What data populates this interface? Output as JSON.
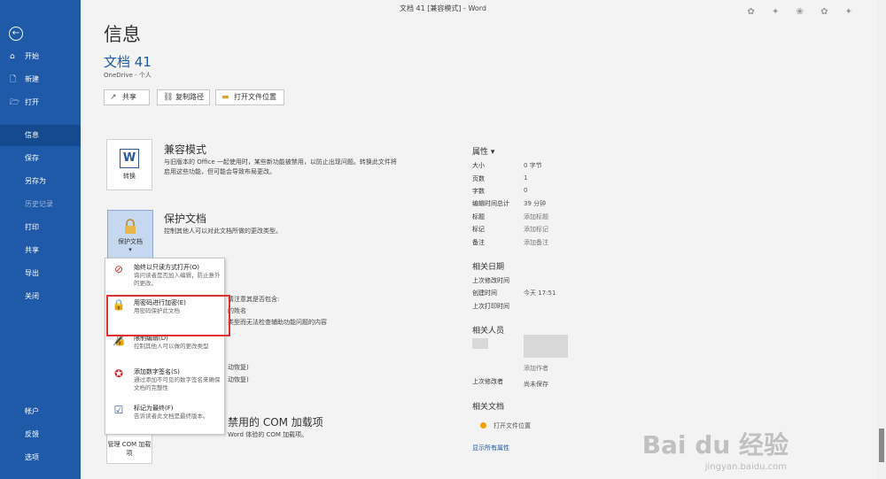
{
  "titlebar": {
    "title": "文档 41 [兼容模式] - Word"
  },
  "nav": {
    "back": "←",
    "items": [
      {
        "label": "开始",
        "icon": "⌂"
      },
      {
        "label": "新建",
        "icon": "🗋"
      },
      {
        "label": "打开",
        "icon": "🗁"
      },
      {
        "label": "信息"
      },
      {
        "label": "保存"
      },
      {
        "label": "另存为"
      },
      {
        "label": "历史记录"
      },
      {
        "label": "打印"
      },
      {
        "label": "共享"
      },
      {
        "label": "导出"
      },
      {
        "label": "关闭"
      },
      {
        "label": "帐户"
      },
      {
        "label": "反馈"
      },
      {
        "label": "选项"
      }
    ]
  },
  "main": {
    "title": "信息",
    "doc_name": "文档 41",
    "location": "OneDrive - 个人",
    "buttons": {
      "share": "共享",
      "copy_path": "复制路径",
      "open_location": "打开文件位置"
    }
  },
  "compat": {
    "button": "转换",
    "title": "兼容模式",
    "desc1": "与旧版本的 Office 一起使用时，某些新功能被禁用，以防止出现问题。转换此文件将",
    "desc2": "启用这些功能，但可能会导致布局更改。"
  },
  "protect": {
    "button": "保护文档",
    "title": "保护文档",
    "desc": "控制其他人可以对此文档所做的更改类型。"
  },
  "fragments": {
    "f1": "请注意其是否包含:",
    "f2": "的姓名",
    "f3": "类型而无法检查辅助功能问题的内容",
    "f4": "动恢复)",
    "f5": "动恢复)",
    "com_title": "禁用的 COM 加载项",
    "com_desc": "Word 体验的 COM 加载项。",
    "com_button": "管理 COM 加载项"
  },
  "menu": {
    "items": [
      {
        "title": "始终以只读方式打开(O)",
        "desc": "询问读者是否加入编辑，防止意外的更改。"
      },
      {
        "title": "用密码进行加密(E)",
        "desc": "用密码保护此文档"
      },
      {
        "title": "限制编辑(D)",
        "desc": "控制其他人可以做的更改类型"
      },
      {
        "title": "添加数字签名(S)",
        "desc": "通过添加不可见的数字签名来确保文档的完整性"
      },
      {
        "title": "标记为最终(F)",
        "desc": "告诉读者此文档是最终版本。"
      }
    ]
  },
  "properties": {
    "heading": "属性",
    "rows": [
      {
        "label": "大小",
        "value": "0 字节"
      },
      {
        "label": "页数",
        "value": "1"
      },
      {
        "label": "字数",
        "value": "0"
      },
      {
        "label": "编辑时间总计",
        "value": "39 分钟"
      },
      {
        "label": "标题",
        "value": "添加标题"
      },
      {
        "label": "标记",
        "value": "添加标记"
      },
      {
        "label": "备注",
        "value": "添加备注"
      }
    ],
    "dates_heading": "相关日期",
    "dates": [
      {
        "label": "上次修改时间",
        "value": ""
      },
      {
        "label": "创建时间",
        "value": "今天 17:51"
      },
      {
        "label": "上次打印时间",
        "value": ""
      }
    ],
    "people_heading": "相关人员",
    "add_author": "添加作者",
    "last_modified_by_label": "上次修改者",
    "last_modified_by_value": "尚未保存",
    "docs_heading": "相关文档",
    "open_location": "打开文件位置",
    "show_all": "显示所有属性"
  },
  "watermark": {
    "main": "Bai du 经验",
    "sub": "jingyan.baidu.com"
  }
}
